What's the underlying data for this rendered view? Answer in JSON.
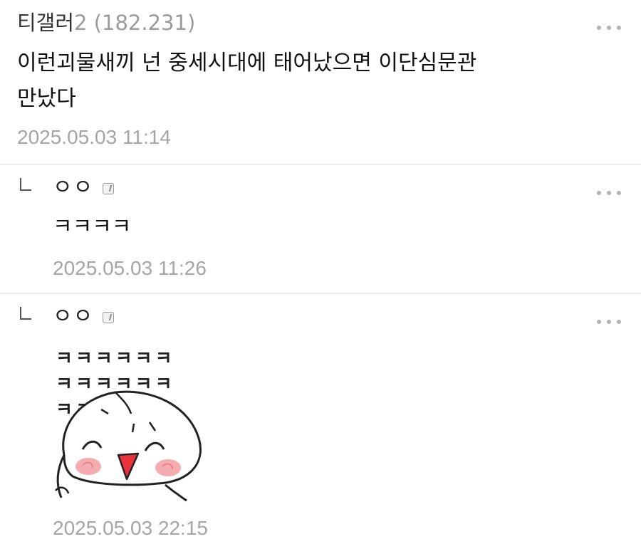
{
  "comments": [
    {
      "author": "티갤러",
      "author_num": "2",
      "ip": "(182.231)",
      "text_line1": "이런괴물새끼 넌 중세시대에 태어났으면 이단심문관",
      "text_line2": "만났다",
      "time": "2025.05.03 11:14"
    },
    {
      "author": "ㅇㅇ",
      "text": "ㅋㅋㅋㅋ",
      "time": "2025.05.03 11:26"
    },
    {
      "author": "ㅇㅇ",
      "sticker_rows": [
        "ㅋㅋㅋㅋㅋㅋ",
        "ㅋㅋㅋㅋㅋㅋ",
        "ㅋㅋ   ㅋㅋ"
      ],
      "time": "2025.05.03 22:15"
    }
  ],
  "icons": {
    "more": "more-options-icon",
    "reply": "reply-arrow-icon",
    "fixed_nick": "fixed-nickname-badge-icon"
  },
  "colors": {
    "text": "#111111",
    "meta": "#a5a5a5",
    "divider": "#ececec",
    "sticker_cheek": "#f4a3a8",
    "sticker_mouth": "#e8323c"
  }
}
